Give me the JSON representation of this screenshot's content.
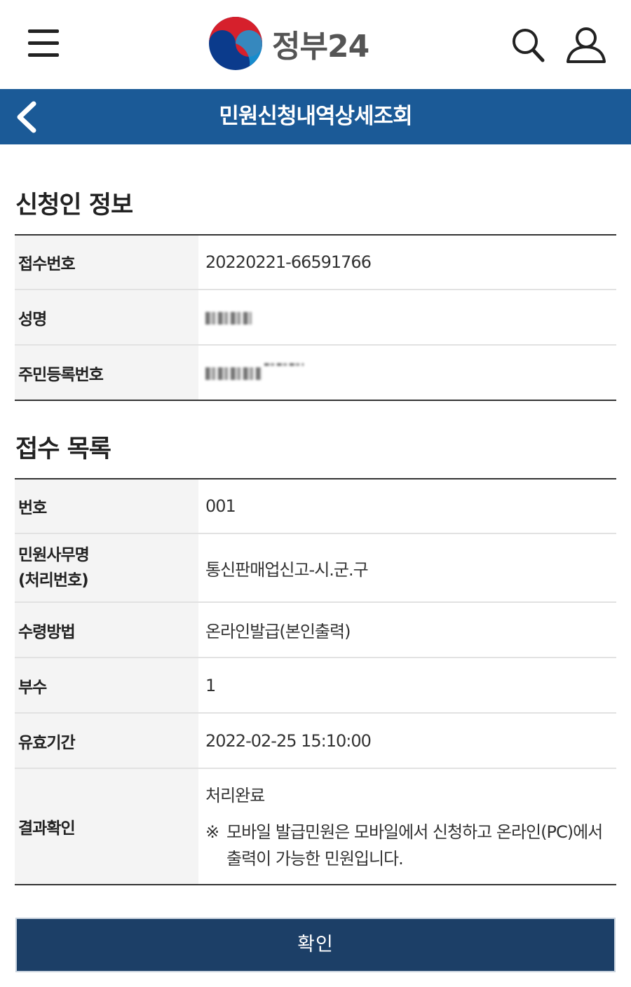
{
  "header": {
    "logo_text": "정부24",
    "icons": [
      "menu-icon",
      "logo-emblem-icon",
      "search-icon",
      "user-icon"
    ]
  },
  "titlebar": {
    "title": "민원신청내역상세조회",
    "back_icon": "chevron-left-icon"
  },
  "applicant": {
    "title": "신청인 정보",
    "rows": [
      {
        "label": "접수번호",
        "value": "20220221-66591766"
      },
      {
        "label": "성명",
        "value": "",
        "masked": true
      },
      {
        "label": "주민등록번호",
        "value": "",
        "masked": true
      }
    ]
  },
  "receipt": {
    "title": "접수 목록",
    "rows": [
      {
        "label": "번호",
        "value": "001"
      },
      {
        "label": "민원사무명\n(처리번호)",
        "value": "통신판매업신고-시.군.구"
      },
      {
        "label": "수령방법",
        "value": "온라인발급(본인출력)"
      },
      {
        "label": "부수",
        "value": "1"
      },
      {
        "label": "유효기간",
        "value": "2022-02-25 15:10:00"
      },
      {
        "label": "결과확인",
        "value": "처리완료",
        "note_mark": "※",
        "note_line1": "모바일 발급민원은 모바일에서 신청하고 온라인(PC)에서",
        "note_line2": "출력이 가능한 민원입니다."
      }
    ]
  },
  "confirm_label": "확인",
  "colors": {
    "titlebar": "#1b5a97",
    "button": "#1c3f67"
  }
}
